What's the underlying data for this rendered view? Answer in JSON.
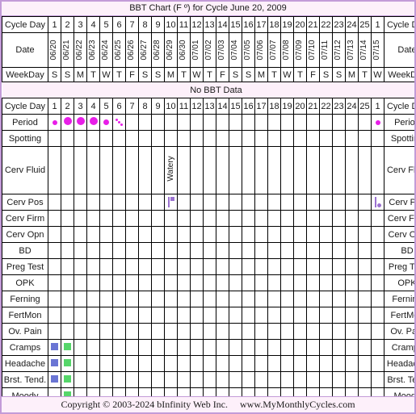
{
  "title": "BBT Chart (F º) for Cycle June 20, 2009",
  "labels": {
    "cycle_day": "Cycle Day",
    "date": "Date",
    "weekday": "WeekDay",
    "no_bbt_data": "No BBT Data"
  },
  "colors": {
    "border_outer": "#c39bd8",
    "header_bg": "#fdf0fa",
    "date_bg": "#faf6e0",
    "weekday_bg": "#ececec",
    "period_marker": "#e81ee8",
    "cerv_pos_marker": "#9b72d0",
    "symptom_blue": "#6a75d4",
    "symptom_green": "#56d66a",
    "grid_line": "#000000"
  },
  "cycle_days": [
    "1",
    "2",
    "3",
    "4",
    "5",
    "6",
    "7",
    "8",
    "9",
    "10",
    "11",
    "12",
    "13",
    "14",
    "15",
    "16",
    "17",
    "18",
    "19",
    "20",
    "21",
    "22",
    "23",
    "24",
    "25",
    "1"
  ],
  "dates": [
    "06/20",
    "06/21",
    "06/22",
    "06/23",
    "06/24",
    "06/25",
    "06/26",
    "06/27",
    "06/28",
    "06/29",
    "06/30",
    "07/01",
    "07/02",
    "07/03",
    "07/04",
    "07/05",
    "07/06",
    "07/07",
    "07/08",
    "07/09",
    "07/10",
    "07/11",
    "07/12",
    "07/13",
    "07/14",
    "07/15"
  ],
  "weekdays": [
    "S",
    "S",
    "M",
    "T",
    "W",
    "T",
    "F",
    "S",
    "S",
    "M",
    "T",
    "W",
    "T",
    "F",
    "S",
    "S",
    "M",
    "T",
    "W",
    "T",
    "F",
    "S",
    "S",
    "M",
    "T",
    "W"
  ],
  "rows": [
    {
      "name": "period",
      "label": "Period",
      "label_right": "Period",
      "markers": [
        {
          "day": 1,
          "type": "dot",
          "size": 6
        },
        {
          "day": 2,
          "type": "dot",
          "size": 10
        },
        {
          "day": 3,
          "type": "dot",
          "size": 10
        },
        {
          "day": 4,
          "type": "dot",
          "size": 10
        },
        {
          "day": 5,
          "type": "dot",
          "size": 7
        },
        {
          "day": 6,
          "type": "spotting"
        },
        {
          "day": 26,
          "type": "dot",
          "size": 6
        }
      ]
    },
    {
      "name": "spotting",
      "label": "Spotting",
      "label_right": "Spotting",
      "markers": []
    },
    {
      "name": "cerv-fluid",
      "label": "Cerv Fluid",
      "label_right": "Cerv Fluid",
      "tall": true,
      "markers": [
        {
          "day": 10,
          "type": "vtext",
          "text": "Watery"
        }
      ]
    },
    {
      "name": "cerv-pos",
      "label": "Cerv Pos",
      "label_right": "Cerv Pos",
      "markers": [
        {
          "day": 10,
          "type": "pos",
          "knob": "top"
        },
        {
          "day": 26,
          "type": "pos",
          "knob": "bottom"
        }
      ]
    },
    {
      "name": "cerv-firm",
      "label": "Cerv Firm",
      "label_right": "Cerv Firm",
      "markers": []
    },
    {
      "name": "cerv-opn",
      "label": "Cerv Opn",
      "label_right": "Cerv Opn",
      "markers": []
    },
    {
      "name": "bd",
      "label": "BD",
      "label_right": "BD",
      "markers": []
    },
    {
      "name": "preg-test",
      "label": "Preg Test",
      "label_right": "Preg Test",
      "markers": []
    },
    {
      "name": "opk",
      "label": "OPK",
      "label_right": "OPK",
      "markers": []
    },
    {
      "name": "ferning",
      "label": "Ferning",
      "label_right": "Ferning",
      "markers": []
    },
    {
      "name": "fertmon",
      "label": "FertMon",
      "label_right": "FertMon",
      "markers": []
    },
    {
      "name": "ov-pain",
      "label": "Ov. Pain",
      "label_right": "Ov. Pain",
      "markers": []
    },
    {
      "name": "cramps",
      "label": "Cramps",
      "label_right": "Cramps",
      "markers": [
        {
          "day": 1,
          "type": "square",
          "color": "#6a75d4"
        },
        {
          "day": 2,
          "type": "square",
          "color": "#56d66a"
        }
      ]
    },
    {
      "name": "headache",
      "label": "Headache",
      "label_right": "Headache",
      "markers": [
        {
          "day": 1,
          "type": "square",
          "color": "#6a75d4"
        },
        {
          "day": 2,
          "type": "square",
          "color": "#56d66a"
        }
      ]
    },
    {
      "name": "brst-tend",
      "label": "Brst. Tend.",
      "label_right": "Brst. Tend",
      "markers": [
        {
          "day": 1,
          "type": "square",
          "color": "#6a75d4"
        },
        {
          "day": 2,
          "type": "square",
          "color": "#56d66a"
        }
      ]
    },
    {
      "name": "moody",
      "label": "Moody",
      "label_right": "Moody",
      "markers": [
        {
          "day": 2,
          "type": "square",
          "color": "#56d66a"
        }
      ]
    }
  ],
  "footer": {
    "copyright": "Copyright © 2003-2024 bInfinity Web Inc.",
    "website": "www.MyMonthlyCycles.com"
  }
}
